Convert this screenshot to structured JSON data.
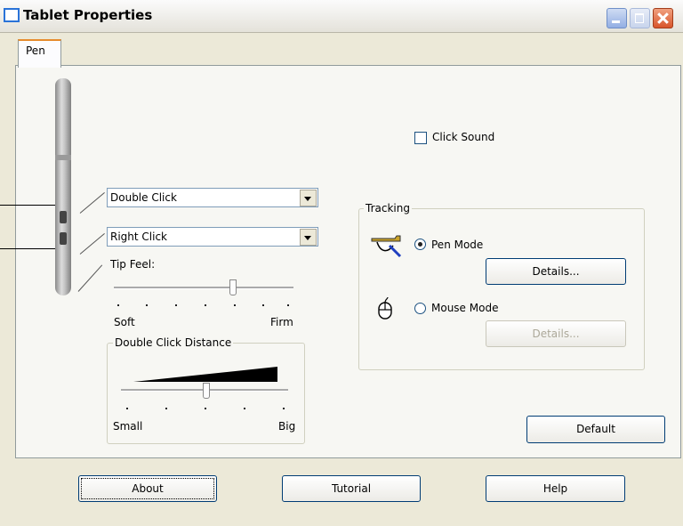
{
  "window": {
    "title": "Tablet Properties"
  },
  "tabs": [
    {
      "label": "Pen"
    }
  ],
  "pen_buttons": {
    "upper": {
      "value": "Double Click"
    },
    "lower": {
      "value": "Right Click"
    }
  },
  "tip_feel": {
    "label": "Tip Feel:",
    "min_label": "Soft",
    "max_label": "Firm",
    "level_fraction": 0.67
  },
  "double_click_distance": {
    "title": "Double Click Distance",
    "min_label": "Small",
    "max_label": "Big",
    "level_fraction": 0.5
  },
  "click_sound": {
    "label": "Click Sound",
    "checked": false
  },
  "tracking": {
    "title": "Tracking",
    "pen_mode": {
      "label": "Pen Mode",
      "selected": true,
      "details_label": "Details..."
    },
    "mouse_mode": {
      "label": "Mouse Mode",
      "selected": false,
      "details_label": "Details..."
    }
  },
  "buttons": {
    "default": "Default",
    "about": "About",
    "tutorial": "Tutorial",
    "help": "Help"
  },
  "icons": {
    "title": "window-icon",
    "pen_mode": "pen-hand-icon",
    "mouse_mode": "mouse-icon"
  },
  "colors": {
    "accent": "#e68b2c",
    "close": "#d8552b",
    "button_border": "#003c74"
  }
}
